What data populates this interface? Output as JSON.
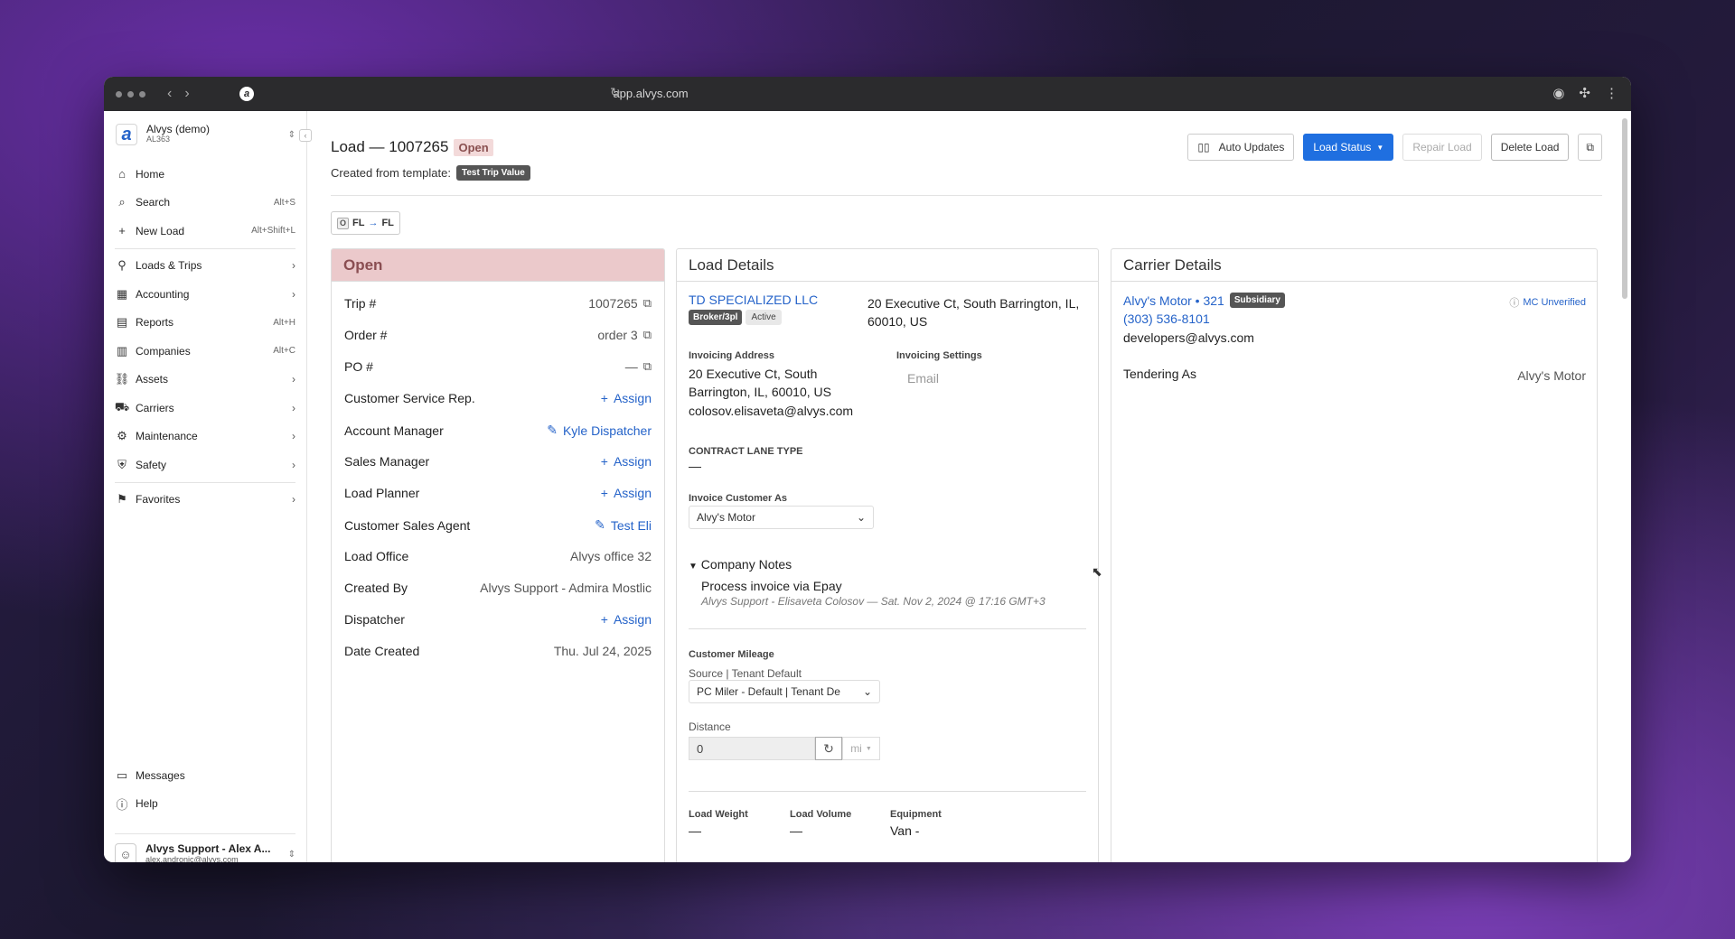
{
  "browser": {
    "url": "app.alvys.com"
  },
  "org": {
    "name": "Alvys (demo)",
    "code": "AL363"
  },
  "nav": {
    "home": "Home",
    "search": "Search",
    "search_shortcut": "Alt+S",
    "new_load": "New Load",
    "new_load_shortcut": "Alt+Shift+L",
    "loads_trips": "Loads & Trips",
    "accounting": "Accounting",
    "reports": "Reports",
    "reports_shortcut": "Alt+H",
    "companies": "Companies",
    "companies_shortcut": "Alt+C",
    "assets": "Assets",
    "carriers": "Carriers",
    "maintenance": "Maintenance",
    "safety": "Safety",
    "favorites": "Favorites",
    "messages": "Messages",
    "help": "Help"
  },
  "user": {
    "name": "Alvys Support - Alex A...",
    "email": "alex.andronic@alvys.com"
  },
  "header": {
    "title": "Load — 1007265",
    "status": "Open",
    "template_label": "Created from template:",
    "template_name": "Test Trip Value",
    "route_origin_state": "FL",
    "route_dest_state": "FL",
    "route_marker": "O"
  },
  "actions": {
    "auto_updates": "Auto Updates",
    "load_status": "Load Status",
    "repair_load": "Repair Load",
    "delete_load": "Delete Load"
  },
  "status_panel": {
    "title": "Open",
    "rows": [
      {
        "label": "Trip #",
        "value": "1007265"
      },
      {
        "label": "Order #",
        "value": "order 3"
      },
      {
        "label": "PO #",
        "value": "—"
      },
      {
        "label": "Customer Service Rep.",
        "value": "Assign"
      },
      {
        "label": "Account Manager",
        "value": "Kyle Dispatcher"
      },
      {
        "label": "Sales Manager",
        "value": "Assign"
      },
      {
        "label": "Load Planner",
        "value": "Assign"
      },
      {
        "label": "Customer Sales Agent",
        "value": "Test Eli"
      },
      {
        "label": "Load Office",
        "value": "Alvys office 32"
      },
      {
        "label": "Created By",
        "value": "Alvys Support - Admira Mostlic"
      },
      {
        "label": "Dispatcher",
        "value": "Assign"
      },
      {
        "label": "Date Created",
        "value": "Thu. Jul 24, 2025"
      }
    ]
  },
  "load_details": {
    "title": "Load Details",
    "customer_name": "TD SPECIALIZED LLC",
    "customer_badge_type": "Broker/3pl",
    "customer_badge_status": "Active",
    "customer_address": "20 Executive Ct, South Barrington, IL, 60010, US",
    "invoicing_address_label": "Invoicing Address",
    "invoicing_address": "20 Executive Ct, South Barrington, IL, 60010, US",
    "invoicing_email": "colosov.elisaveta@alvys.com",
    "invoicing_settings_label": "Invoicing Settings",
    "invoicing_settings_value": "Email",
    "contract_lane_label": "CONTRACT LANE TYPE",
    "contract_lane_value": "—",
    "invoice_customer_as_label": "Invoice Customer As",
    "invoice_customer_as_value": "Alvy's Motor",
    "company_notes_label": "Company Notes",
    "note_text": "Process invoice via Epay",
    "note_meta": "Alvys Support - Elisaveta Colosov — Sat. Nov 2, 2024 @ 17:16 GMT+3",
    "customer_mileage_label": "Customer Mileage",
    "source_label": "Source | Tenant Default",
    "source_value": "PC Miler - Default | Tenant De",
    "distance_label": "Distance",
    "distance_value": "0",
    "distance_unit": "mi",
    "load_weight_label": "Load Weight",
    "load_weight_value": "—",
    "load_volume_label": "Load Volume",
    "load_volume_value": "—",
    "equipment_label": "Equipment",
    "equipment_value": "Van  -"
  },
  "carrier_details": {
    "title": "Carrier Details",
    "carrier_name": "Alvy's Motor • 321",
    "carrier_badge": "Subsidiary",
    "mc_status": "MC Unverified",
    "phone": "(303) 536-8101",
    "email": "developers@alvys.com",
    "tendering_as_label": "Tendering As",
    "tendering_as_value": "Alvy's Motor"
  },
  "colors": {
    "accent": "#1f6fe0",
    "link": "#2563c9",
    "status_header_bg": "#ebc9cb"
  }
}
